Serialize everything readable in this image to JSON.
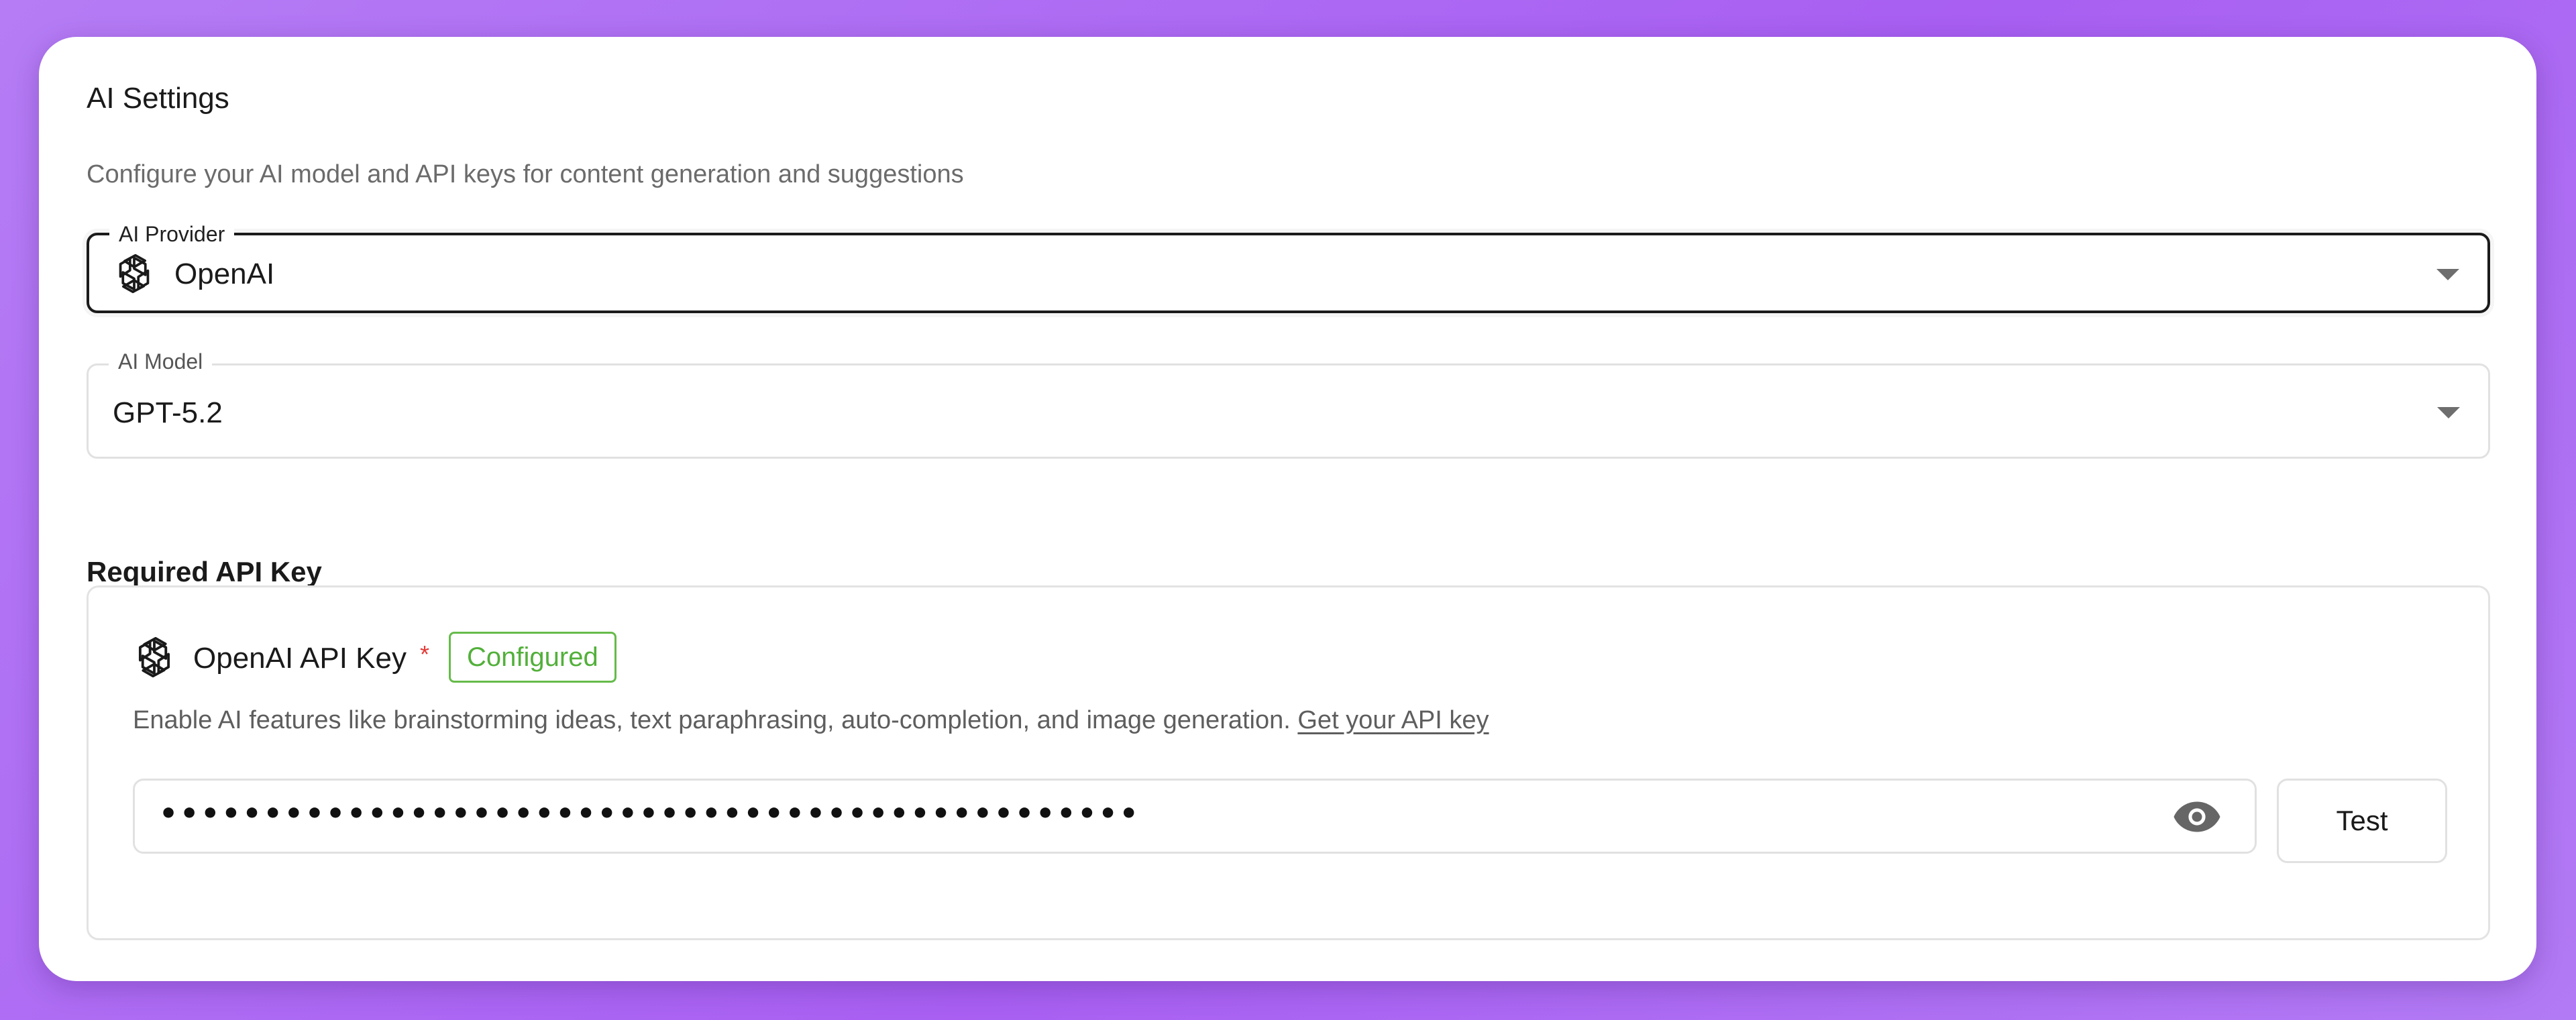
{
  "panel": {
    "title": "AI Settings",
    "subtitle": "Configure your AI model and API keys for content generation and suggestions"
  },
  "provider": {
    "label": "AI Provider",
    "value": "OpenAI",
    "icon": "openai-logo-icon"
  },
  "model": {
    "label": "AI Model",
    "value": "GPT-5.2"
  },
  "api_key_section": {
    "title": "Required API Key",
    "key_label": "OpenAI API Key",
    "required_marker": "*",
    "status_badge": "Configured",
    "description": "Enable AI features like brainstorming ideas, text paraphrasing, auto-completion, and image generation.",
    "link_text": "Get your API key",
    "masked_value": "•••••••••••••••••••••••••••••••••••••••••••••••",
    "reveal_icon": "eye-icon",
    "test_button": "Test"
  },
  "colors": {
    "background": "#a85ff2",
    "badge_green": "#52b03a",
    "required_red": "#e53935"
  }
}
